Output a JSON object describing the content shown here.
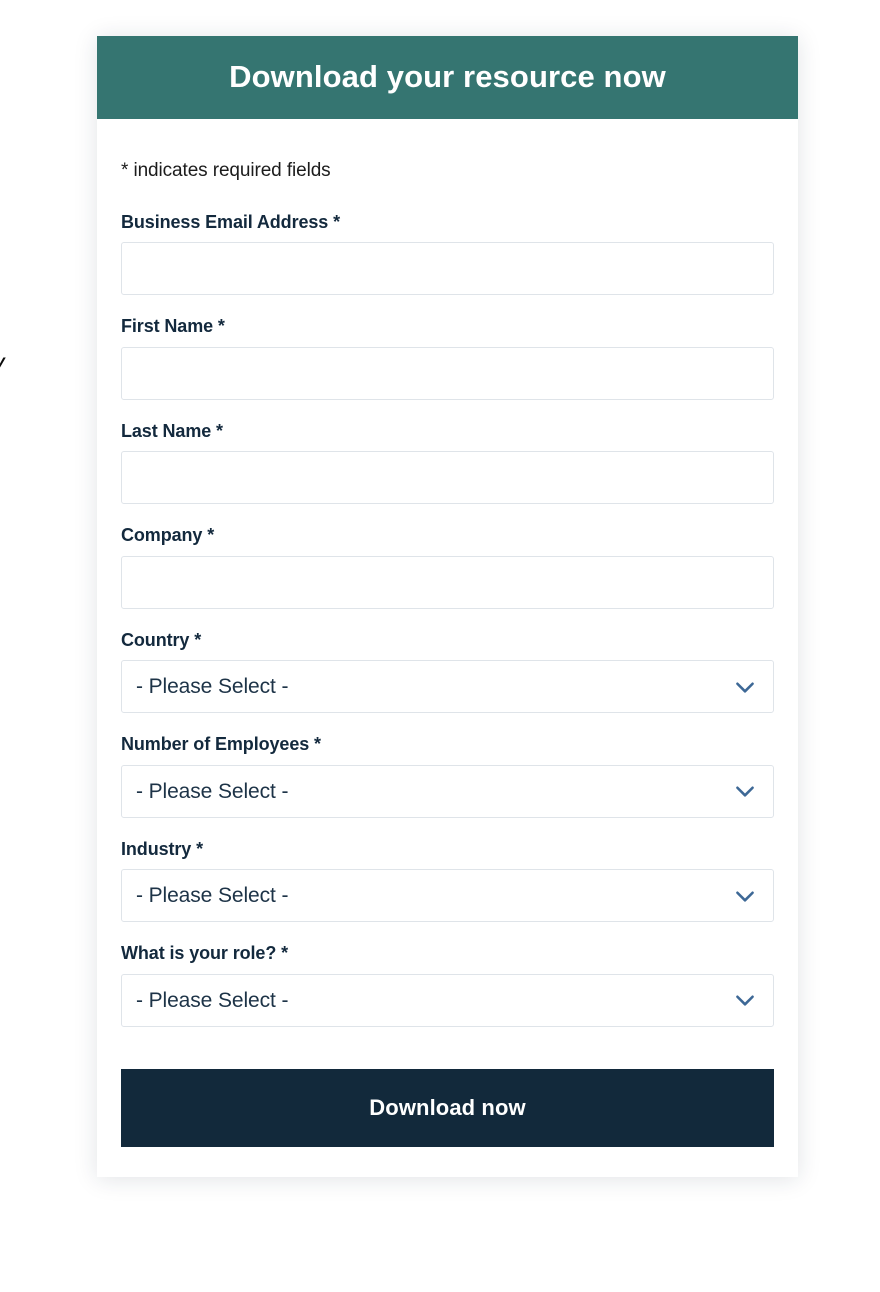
{
  "bleed": {
    "left_fragment": "y"
  },
  "form": {
    "header": {
      "title": "Download your resource now",
      "background_color": "#357571",
      "text_color": "#ffffff"
    },
    "required_note": "* indicates required fields",
    "fields": [
      {
        "label": "Business Email Address *",
        "type": "text",
        "value": "",
        "placeholder": ""
      },
      {
        "label": "First Name *",
        "type": "text",
        "value": "",
        "placeholder": ""
      },
      {
        "label": "Last Name *",
        "type": "text",
        "value": "",
        "placeholder": ""
      },
      {
        "label": "Company *",
        "type": "text",
        "value": "",
        "placeholder": ""
      },
      {
        "label": "Country *",
        "type": "select",
        "value": "- Please Select -",
        "icon": "chevron-down-icon"
      },
      {
        "label": "Number of Employees *",
        "type": "select",
        "value": "- Please Select -",
        "icon": "chevron-down-icon"
      },
      {
        "label": "Industry *",
        "type": "select",
        "value": "- Please Select -",
        "icon": "chevron-down-icon"
      },
      {
        "label": "What is your role? *",
        "type": "select",
        "value": "- Please Select -",
        "icon": "chevron-down-icon"
      }
    ],
    "submit": {
      "label": "Download now",
      "background_color": "#12293b",
      "text_color": "#ffffff"
    },
    "colors": {
      "label_text": "#13293d",
      "input_border": "#dfe4e9",
      "chevron": "#3d6896",
      "card_background": "#ffffff"
    }
  }
}
